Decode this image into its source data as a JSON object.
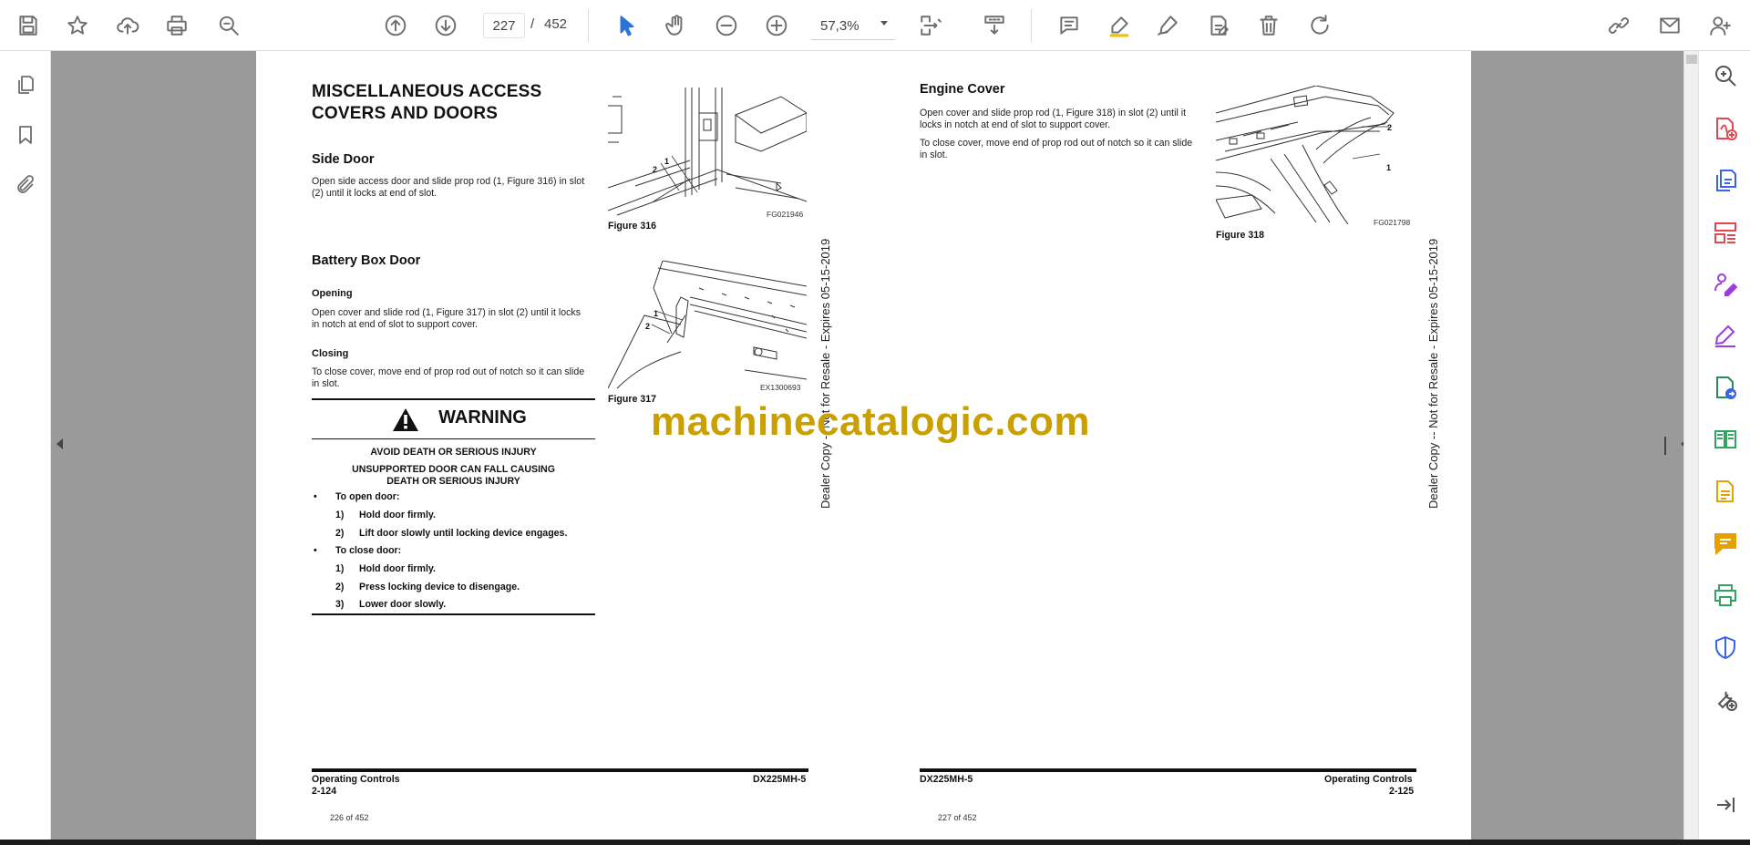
{
  "toolbar": {
    "page_current": "227",
    "page_sep": "/",
    "page_total": "452",
    "zoom": "57,3%"
  },
  "left_page": {
    "title_line1": "MISCELLANEOUS ACCESS",
    "title_line2": "COVERS AND DOORS",
    "side_door_heading": "Side Door",
    "side_door_text_1": "Open side access door and slide prop rod (1, Figure 316) in slot",
    "side_door_text_2": "(2) until it locks at end of slot.",
    "battery_heading": "Battery Box Door",
    "opening_heading": "Opening",
    "opening_text_1": "Open cover and slide rod (1, Figure 317) in slot (2) until it locks",
    "opening_text_2": "in notch at end of slot to support cover.",
    "closing_heading": "Closing",
    "closing_text_1": "To close cover, move end of prop rod out of notch so it can slide",
    "closing_text_2": "in slot.",
    "fig316_caption": "Figure 316",
    "fig316_code": "FG021946",
    "fig316_label_1": "1",
    "fig316_label_2": "2",
    "fig317_caption": "Figure 317",
    "fig317_code": "EX1300693",
    "fig317_label_1": "1",
    "fig317_label_2": "2",
    "warning": {
      "title": "WARNING",
      "line1": "AVOID DEATH OR SERIOUS INJURY",
      "line2": "UNSUPPORTED DOOR CAN FALL CAUSING",
      "line3": "DEATH OR SERIOUS INJURY",
      "bullet1": "To open door:",
      "open_steps": [
        {
          "n": "1)",
          "t": "Hold door firmly."
        },
        {
          "n": "2)",
          "t": "Lift door slowly until locking device engages."
        }
      ],
      "bullet2": "To close door:",
      "close_steps": [
        {
          "n": "1)",
          "t": "Hold door firmly."
        },
        {
          "n": "2)",
          "t": "Press locking device to disengage."
        },
        {
          "n": "3)",
          "t": "Lower door slowly."
        }
      ]
    },
    "footer_left_1": "Operating Controls",
    "footer_left_2": "2-124",
    "footer_right": "DX225MH-5",
    "page_count": "226 of 452",
    "vertical_text": "Dealer Copy -- Not for Resale - Expires 05-15-2019"
  },
  "right_page": {
    "heading": "Engine Cover",
    "text_1": "Open cover and slide prop rod (1, Figure 318) in slot (2) until it",
    "text_2": "locks in notch at end of slot to support cover.",
    "text_3": "To close cover, move end of prop rod out of notch so it can slide",
    "text_4": "in slot.",
    "fig318_caption": "Figure 318",
    "fig318_code": "FG021798",
    "fig318_label_1": "1",
    "fig318_label_2": "2",
    "footer_left": "DX225MH-5",
    "footer_right_1": "Operating Controls",
    "footer_right_2": "2-125",
    "page_count": "227 of 452",
    "vertical_text": "Dealer Copy -- Not for Resale - Expires 05-15-2019"
  },
  "watermark": "machinecatalogic.com",
  "icon_colors": {
    "export_pdf": "#e34850",
    "create_pdf": "#3b63e8",
    "organize": "#e34850",
    "request_sign": "#9c3fd6",
    "fill_sign": "#9c3fd6",
    "send_review": "#2a8a5a",
    "compare": "#33a364",
    "scan": "#e6a100",
    "comment": "#e6a100",
    "print_production": "#33a364",
    "protect": "#3b63e8",
    "more_tools": "#555555"
  }
}
